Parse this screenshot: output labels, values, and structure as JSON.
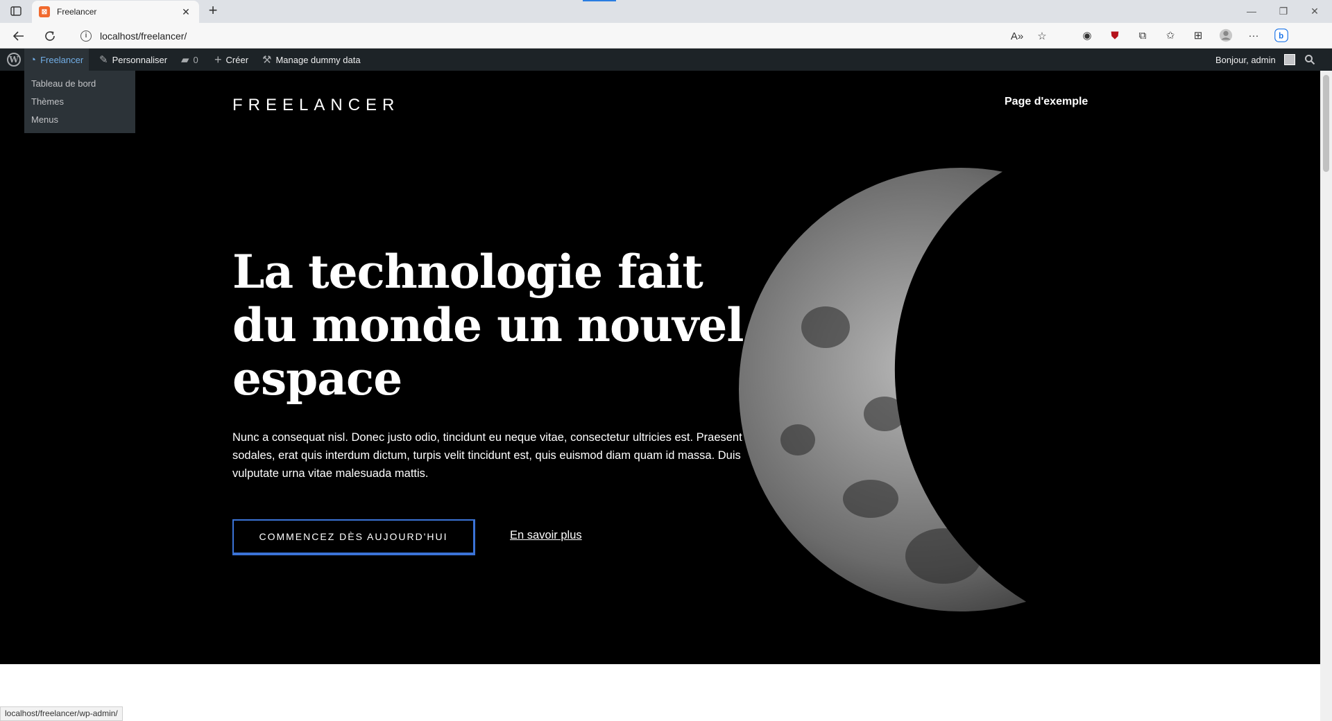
{
  "browser": {
    "tab_title": "Freelancer",
    "url": "localhost/freelancer/",
    "status_url": "localhost/freelancer/wp-admin/"
  },
  "adminbar": {
    "site_name": "Freelancer",
    "customize": "Personnaliser",
    "comments_count": "0",
    "new": "Créer",
    "dummy": "Manage dummy data",
    "greeting": "Bonjour, admin",
    "dropdown": [
      "Tableau de bord",
      "Thèmes",
      "Menus"
    ]
  },
  "site": {
    "title": "FREELANCER",
    "nav_item": "Page d'exemple"
  },
  "hero": {
    "heading": "La technologie fait du monde un nouvel espace",
    "text": "Nunc a consequat nisl. Donec justo odio, tincidunt eu neque vitae, consectetur ultricies est. Praesent sodales, erat quis interdum dictum, turpis velit tincidunt est, quis euismod diam quam id massa. Duis vulputate urna vitae malesuada mattis.",
    "cta": "COMMENCEZ DÈS AUJOURD'HUI",
    "learn_more": "En savoir plus"
  },
  "colors": {
    "adminbar_bg": "#1d2327",
    "adminbar_active": "#72aee6",
    "cta_border": "#3b73d6",
    "hero_bg": "#000000"
  }
}
